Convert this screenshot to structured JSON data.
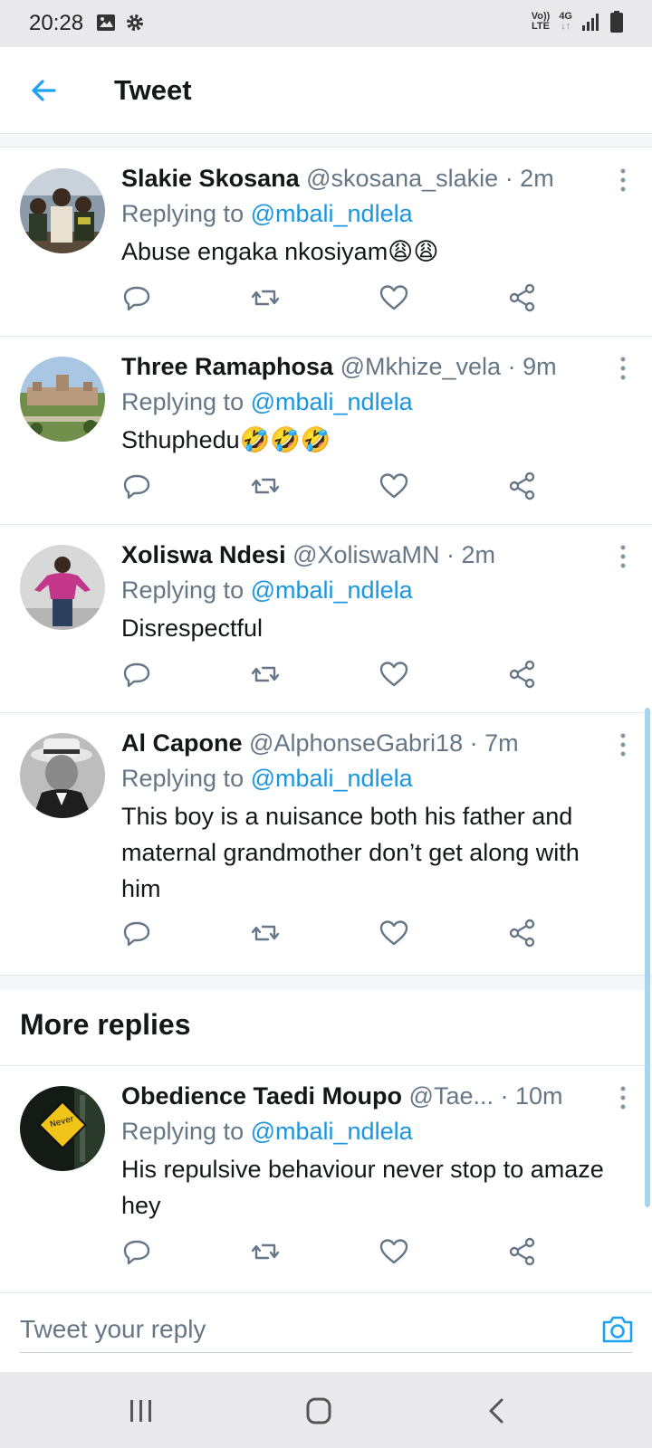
{
  "status_bar": {
    "time": "20:28",
    "volte": "Vo))",
    "lte": "LTE",
    "network": "4G",
    "network_arrows": "↓↑"
  },
  "header": {
    "title": "Tweet"
  },
  "tweets": [
    {
      "name": "Slakie Skosana",
      "handle": "@skosana_slakie",
      "time": "· 2m",
      "replying_prefix": "Replying to ",
      "mention": "@mbali_ndlela",
      "text": "Abuse engaka nkosiyam😩😩"
    },
    {
      "name": "Three Ramaphosa",
      "handle": "@Mkhize_vela",
      "time": "· 9m",
      "replying_prefix": "Replying to ",
      "mention": "@mbali_ndlela",
      "text": "Sthuphedu🤣🤣🤣"
    },
    {
      "name": "Xoliswa Ndesi",
      "handle": "@XoliswaMN",
      "time": "· 2m",
      "replying_prefix": "Replying to ",
      "mention": "@mbali_ndlela",
      "text": "Disrespectful"
    },
    {
      "name": "Al Capone",
      "handle": "@AlphonseGabri18",
      "time": "· 7m",
      "replying_prefix": "Replying to ",
      "mention": "@mbali_ndlela",
      "text": "This boy is a nuisance both his father and maternal grandmother don’t get along with him"
    },
    {
      "name": "Obedience Taedi Moupo",
      "handle": "@Tae...",
      "time": "· 10m",
      "replying_prefix": "Replying to ",
      "mention": "@mbali_ndlela",
      "text": "His repulsive behaviour never stop to amaze hey"
    }
  ],
  "more_replies": {
    "title": "More replies"
  },
  "reply_bar": {
    "placeholder": "Tweet your reply"
  },
  "colors": {
    "accent": "#1b95e0",
    "secondary_text": "#657786",
    "divider": "#e1e8ed"
  }
}
